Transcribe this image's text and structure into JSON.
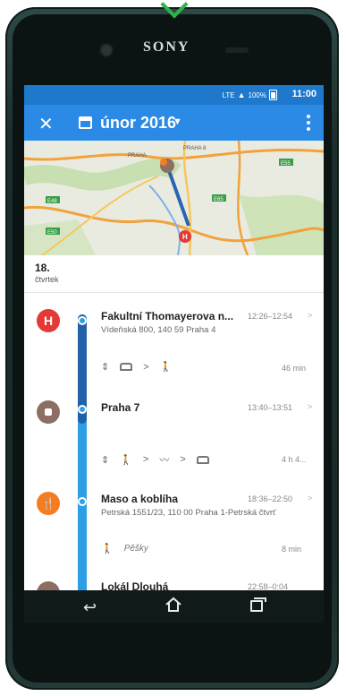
{
  "device": {
    "brand": "SONY"
  },
  "status_bar": {
    "network": "LTE",
    "battery": "100%",
    "time": "11:00"
  },
  "app_bar": {
    "title": "únor 2016"
  },
  "map": {
    "labels": [
      "PRAHA",
      "PRAHA 8",
      "E55",
      "E65",
      "E50",
      "E48"
    ]
  },
  "day": {
    "number": "18.",
    "name": "čtvrtek"
  },
  "items": [
    {
      "name": "Fakultní Thomayerova n...",
      "address": "Vídeňská 800, 140 59 Praha 4",
      "time": "12:26–12:54",
      "icon": "hospital-icon",
      "icon_letter": "H",
      "color": "#e53935",
      "movement": {
        "duration": "46 min"
      }
    },
    {
      "name": "Praha 7",
      "address": "",
      "time": "13:40–13:51",
      "icon": "place-icon",
      "color": "#8d6e63",
      "movement": {
        "duration": "4 h 4..."
      }
    },
    {
      "name": "Maso a koblíha",
      "address": "Petrská 1551/23, 110 00 Praha 1-Petrská čtvrť",
      "time": "18:36–22:50",
      "icon": "restaurant-icon",
      "icon_letter": "🍴",
      "color": "#f57c20",
      "movement": {
        "label": "Pěšky",
        "duration": "8 min"
      }
    },
    {
      "name": "Lokál Dlouhá",
      "time": "22:58–0:04",
      "icon": "place-icon",
      "color": "#8d6e63"
    }
  ]
}
